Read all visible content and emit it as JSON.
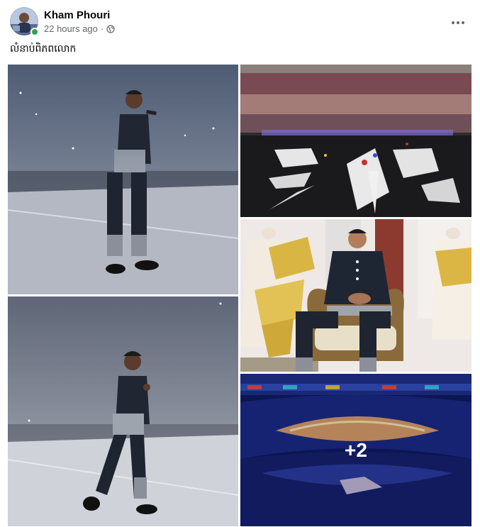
{
  "post": {
    "author": "Kham Phouri",
    "time": "22 hours ago",
    "separator": "·",
    "audience_icon": "globe-icon",
    "more_icon": "more-options-icon",
    "caption": "លំនាប់ពិភពលោក"
  },
  "gallery": {
    "more_count": "+2",
    "tiles": [
      {
        "id": 1,
        "subject": "performer-singing-on-stage"
      },
      {
        "id": 2,
        "subject": "stadium-ceremony-stage"
      },
      {
        "id": 3,
        "subject": "seated-man-traditional-costume"
      },
      {
        "id": 4,
        "subject": "performer-walking-on-stage"
      },
      {
        "id": 5,
        "subject": "stadium-fireworks"
      }
    ]
  },
  "colors": {
    "text_primary": "#050505",
    "text_secondary": "#65676b",
    "online": "#31a24c"
  }
}
